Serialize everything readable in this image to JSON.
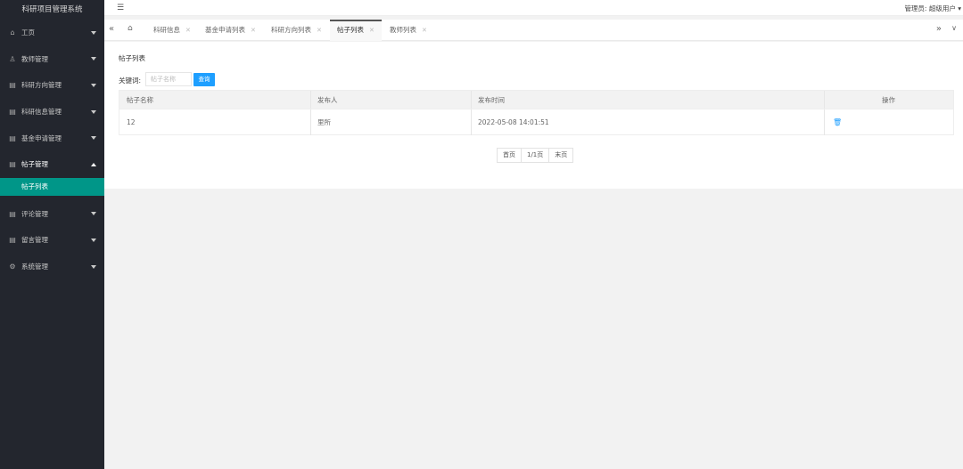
{
  "app": {
    "title": "科研项目管理系统"
  },
  "header": {
    "user_label": "管理员: 超级用户 ▾"
  },
  "sidebar": {
    "items": [
      {
        "label": "工页",
        "icon": "home-icon",
        "open": false
      },
      {
        "label": "教师管理",
        "icon": "user-icon",
        "open": false
      },
      {
        "label": "科研方向管理",
        "icon": "grid-icon",
        "open": false
      },
      {
        "label": "科研信息管理",
        "icon": "grid-icon",
        "open": false
      },
      {
        "label": "基金申请管理",
        "icon": "grid-icon",
        "open": false
      },
      {
        "label": "帖子管理",
        "icon": "grid-icon",
        "open": true,
        "sub": "帖子列表"
      },
      {
        "label": "评论管理",
        "icon": "grid-icon",
        "open": false
      },
      {
        "label": "留言管理",
        "icon": "grid-icon",
        "open": false
      },
      {
        "label": "系统管理",
        "icon": "gear-icon",
        "open": false
      }
    ]
  },
  "tabs": [
    {
      "label": "科研信息",
      "active": false
    },
    {
      "label": "基金申请列表",
      "active": false
    },
    {
      "label": "科研方向列表",
      "active": false
    },
    {
      "label": "帖子列表",
      "active": true
    },
    {
      "label": "教师列表",
      "active": false
    }
  ],
  "main": {
    "title": "帖子列表",
    "search": {
      "label": "关键词:",
      "placeholder": "帖子名称",
      "button": "查询"
    },
    "table": {
      "headers": [
        "帖子名称",
        "发布人",
        "发布时间",
        "操作"
      ],
      "rows": [
        {
          "name": "12",
          "author": "里所",
          "time": "2022-05-08 14:01:51"
        }
      ]
    },
    "pager": {
      "first": "首页",
      "info": "1/1页",
      "last": "末页"
    }
  },
  "colors": {
    "sidebar_bg": "#23262e",
    "accent": "#009688",
    "button": "#1e9fff"
  }
}
